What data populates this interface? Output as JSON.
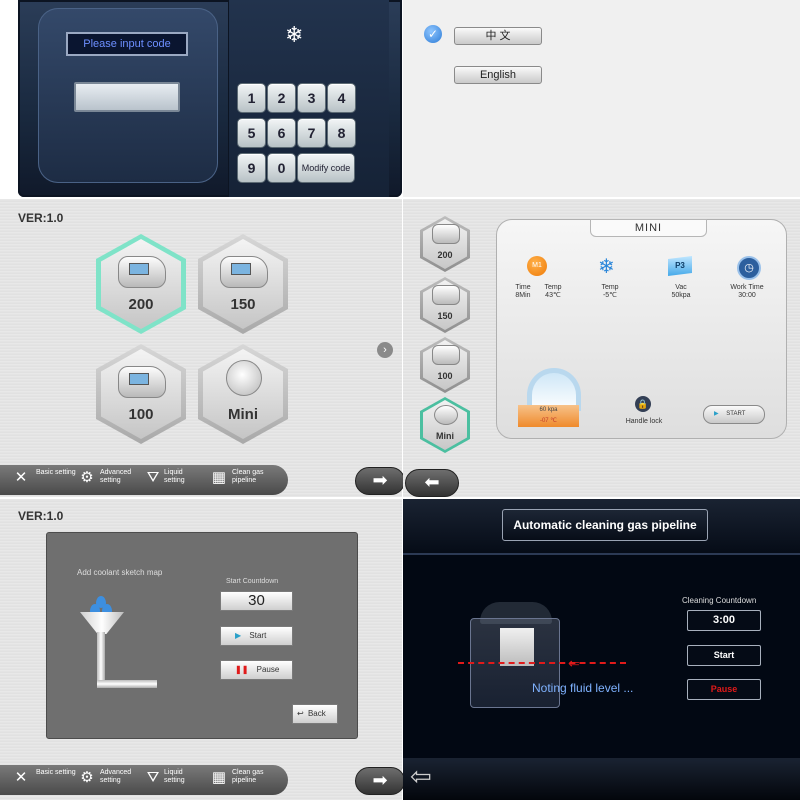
{
  "keypad": {
    "code_prompt": "Please input code",
    "keys": [
      "1",
      "2",
      "3",
      "4",
      "5",
      "6",
      "7",
      "8",
      "9",
      "0"
    ],
    "modify_label": "Modify code",
    "snowflake_icon": "snowflake-icon"
  },
  "language": {
    "options": [
      "中 文",
      "English"
    ],
    "selected": "中 文"
  },
  "handles": {
    "version": "VER:1.0",
    "items": [
      "200",
      "150",
      "100",
      "Mini"
    ],
    "selected": "200"
  },
  "toolbar": {
    "items": [
      "Basic setting",
      "Advanced setting",
      "Liquid setting",
      "Clean gas pipeline"
    ]
  },
  "mini": {
    "title": "MINI",
    "side_items": [
      "200",
      "150",
      "100",
      "Mini"
    ],
    "m1_label": "M1",
    "params": [
      {
        "label": "Time",
        "value": "8Min"
      },
      {
        "label": "Temp",
        "value": "43℃"
      },
      {
        "label": "Temp",
        "value": "-5℃"
      },
      {
        "label": "Vac",
        "value": "50kpa"
      },
      {
        "label": "Work Time",
        "value": "30:00"
      }
    ],
    "p3_label": "P3",
    "pressure": "60 kpa",
    "temperature": "-07 ℃",
    "handle_lock": "Handle lock",
    "start": "START"
  },
  "coolant": {
    "version": "VER:1.0",
    "sketch_label": "Add coolant sketch map",
    "countdown_label": "Start Countdown",
    "countdown_value": "30",
    "start": "Start",
    "pause": "Pause",
    "back": "Back"
  },
  "cleaning": {
    "title": "Automatic cleaning gas pipeline",
    "countdown_label": "Cleaning Countdown",
    "countdown_value": "3:00",
    "start": "Start",
    "pause": "Pause",
    "status": "Noting fluid level ..."
  },
  "colors": {
    "selected_hex": "#7fe3c8",
    "accent_blue": "#2c7bd6",
    "pause_red": "#e01a1a",
    "orange": "#ef8a2c"
  }
}
